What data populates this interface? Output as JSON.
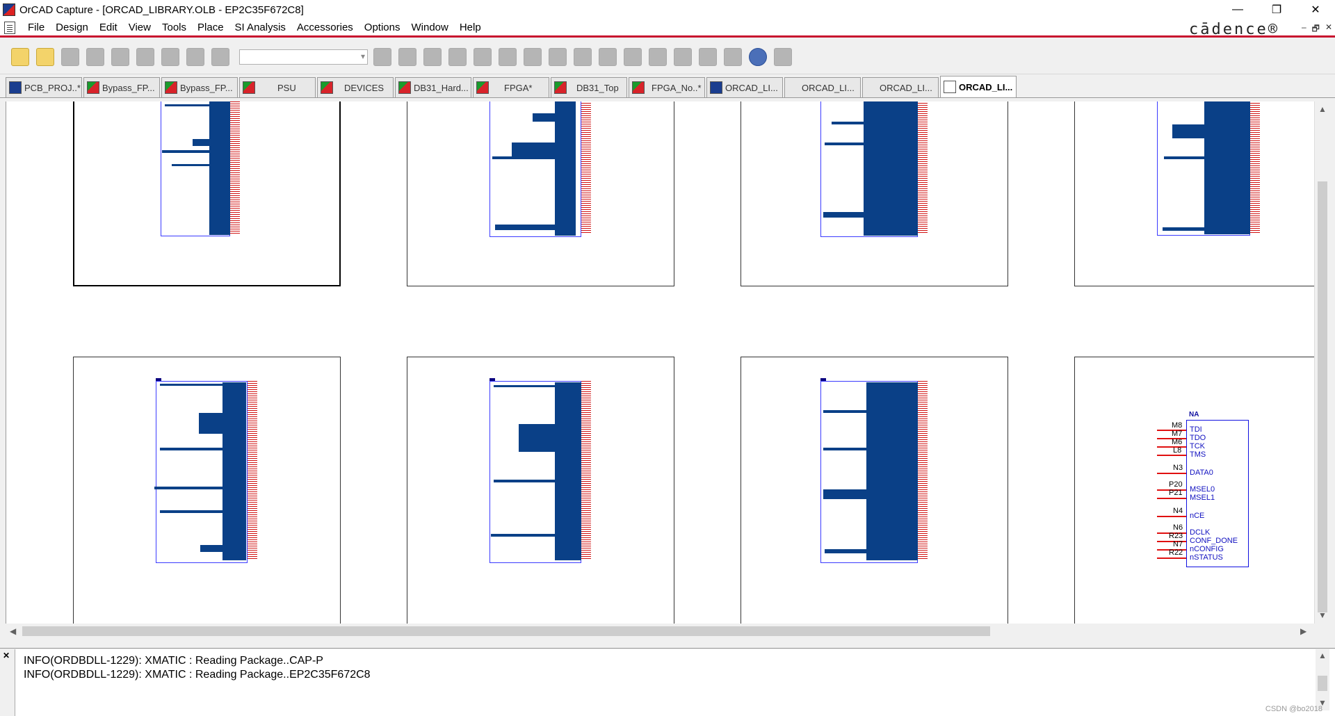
{
  "window": {
    "title": "OrCAD Capture - [ORCAD_LIBRARY.OLB - EP2C35F672C8]",
    "minimize": "—",
    "restore": "❐",
    "close": "✕"
  },
  "menu": {
    "items": [
      "File",
      "Design",
      "Edit",
      "View",
      "Tools",
      "Place",
      "SI Analysis",
      "Accessories",
      "Options",
      "Window",
      "Help"
    ],
    "brand": "cādence®",
    "mdi_min": "–",
    "mdi_restore": "🗗",
    "mdi_close": "✕"
  },
  "toolbar": {
    "combo_value": ""
  },
  "tabs": [
    {
      "label": "PCB_PROJ..*",
      "icon": "project-icon"
    },
    {
      "label": "Bypass_FP...",
      "icon": "schematic-icon"
    },
    {
      "label": "Bypass_FP...",
      "icon": "schematic-icon"
    },
    {
      "label": "PSU",
      "icon": "schematic-icon"
    },
    {
      "label": "DEVICES",
      "icon": "schematic-icon"
    },
    {
      "label": "DB31_Hard...",
      "icon": "schematic-icon"
    },
    {
      "label": "FPGA*",
      "icon": "schematic-icon"
    },
    {
      "label": "DB31_Top",
      "icon": "schematic-icon"
    },
    {
      "label": "FPGA_No..*",
      "icon": "schematic-icon"
    },
    {
      "label": "ORCAD_LI...",
      "icon": "library-icon"
    },
    {
      "label": "ORCAD_LI...",
      "icon": "none"
    },
    {
      "label": "ORCAD_LI...",
      "icon": "none"
    },
    {
      "label": "ORCAD_LI...",
      "icon": "library-part-icon"
    }
  ],
  "jtag_part": {
    "ref": "NA",
    "pins": [
      {
        "num": "M8",
        "name": "TDI"
      },
      {
        "num": "M7",
        "name": "TDO"
      },
      {
        "num": "M6",
        "name": "TCK"
      },
      {
        "num": "L8",
        "name": "TMS"
      },
      {
        "num": "N3",
        "name": "DATA0"
      },
      {
        "num": "P20",
        "name": "MSEL0"
      },
      {
        "num": "P21",
        "name": "MSEL1"
      },
      {
        "num": "N4",
        "name": "nCE"
      },
      {
        "num": "N6",
        "name": "DCLK"
      },
      {
        "num": "R23",
        "name": "CONF_DONE"
      },
      {
        "num": "N7",
        "name": "nCONFIG"
      },
      {
        "num": "R22",
        "name": "nSTATUS"
      }
    ]
  },
  "session_log": {
    "lines": [
      "INFO(ORDBDLL-1229): XMATIC : Reading Package..CAP-P",
      "INFO(ORDBDLL-1229): XMATIC : Reading Package..EP2C35F672C8"
    ],
    "close": "✕"
  },
  "watermark": "CSDN @bo2018",
  "colors": {
    "accent_red": "#c8102e",
    "part_fill": "#0a4087",
    "part_outline": "#3a3aff",
    "pin_red": "#d01010"
  }
}
